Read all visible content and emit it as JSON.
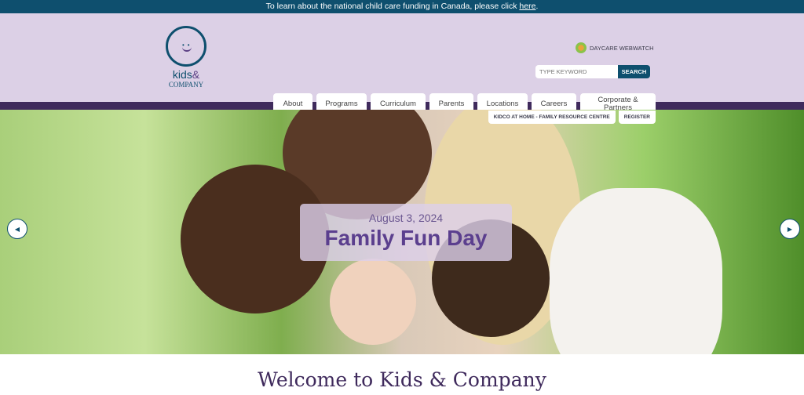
{
  "topbar": {
    "text": "To learn about the national child care funding in Canada, please click ",
    "link": "here",
    "suffix": "."
  },
  "logo": {
    "line1": "kids",
    "amp": "&",
    "line2": "COMPANY"
  },
  "webwatch": {
    "label": "DAYCARE WEBWATCH"
  },
  "search": {
    "placeholder": "TYPE KEYWORD",
    "button": "SEARCH"
  },
  "nav": [
    {
      "label": "About"
    },
    {
      "label": "Programs"
    },
    {
      "label": "Curriculum"
    },
    {
      "label": "Parents"
    },
    {
      "label": "Locations"
    },
    {
      "label": "Careers"
    },
    {
      "label": "Corporate & Partners"
    }
  ],
  "subnav": [
    {
      "label": "KIDCO AT HOME - FAMILY RESOURCE CENTRE"
    },
    {
      "label": "REGISTER"
    }
  ],
  "hero": {
    "date": "August 3, 2024",
    "title": "Family Fun Day",
    "prev": "◀",
    "next": "▶"
  },
  "welcome": "Welcome to Kids & Company"
}
